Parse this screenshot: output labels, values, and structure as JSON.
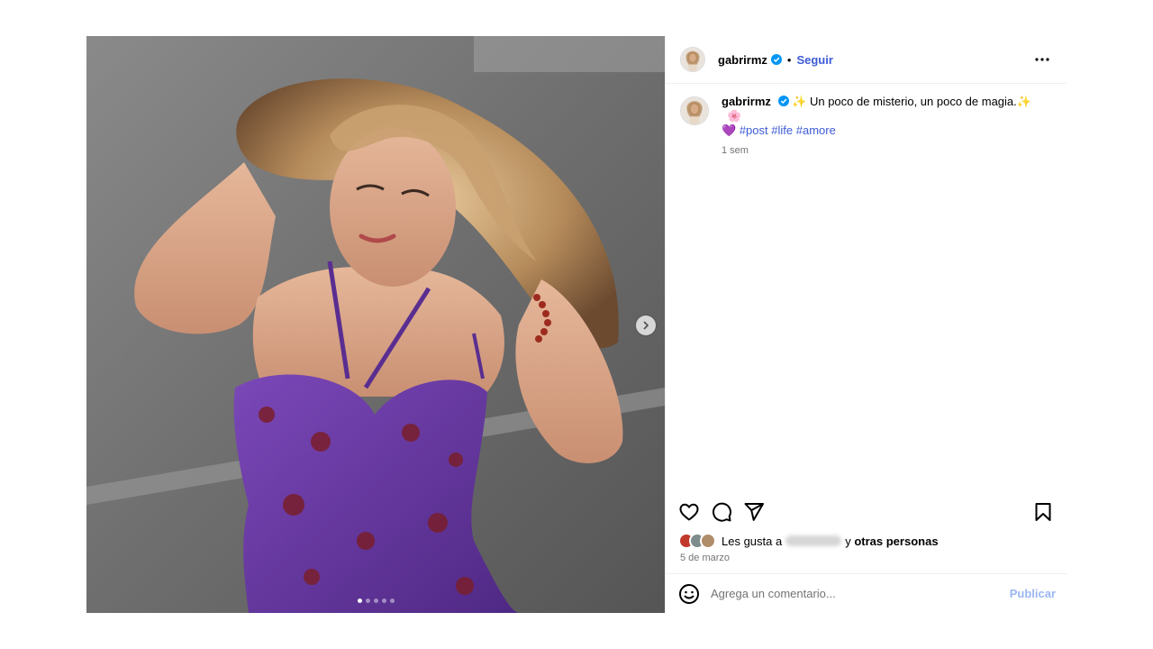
{
  "post": {
    "username": "gabrirmz",
    "verified": true,
    "separator": "•",
    "follow_label": "Seguir",
    "more_icon": "more-horizontal-icon",
    "caption": {
      "emoji_start": "✨",
      "text": "Un poco de misterio, un poco de magia.",
      "emoji_end": "✨",
      "emoji_flower": "🌸",
      "emoji_heart": "💜",
      "hashtags": [
        "#post",
        "#life",
        "#amore"
      ],
      "time": "1 sem"
    },
    "carousel": {
      "slides": 5,
      "current": 1,
      "next_icon": "chevron-right-icon"
    },
    "actions": {
      "like_icon": "heart-icon",
      "comment_icon": "comment-icon",
      "share_icon": "send-icon",
      "save_icon": "bookmark-icon"
    },
    "likes": {
      "prefix": "Les gusta a",
      "suffix_joiner": "y",
      "suffix": "otras personas"
    },
    "date": "5 de marzo",
    "comment": {
      "placeholder": "Agrega un comentario...",
      "publish_label": "Publicar",
      "emoji_icon": "smiley-icon"
    },
    "colors": {
      "link": "#3d5bd6",
      "publish_disabled": "#9bb7f3",
      "verified": "#0095f6",
      "dress": "#6a3aa0"
    }
  }
}
